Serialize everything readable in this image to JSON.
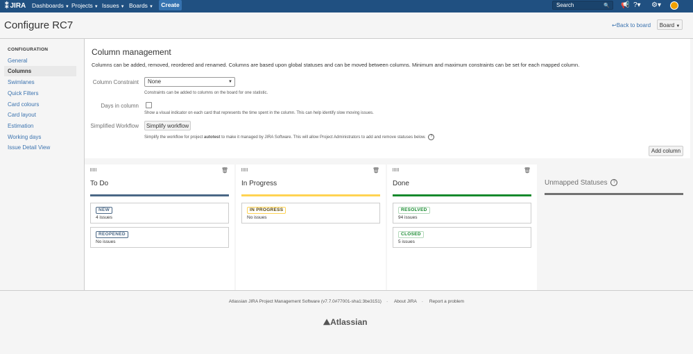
{
  "topnav": {
    "logo": "JIRA",
    "dashboards": "Dashboards",
    "projects": "Projects",
    "issues": "Issues",
    "boards": "Boards",
    "create": "Create",
    "search_placeholder": "Search"
  },
  "header": {
    "title": "Configure RC7",
    "back_label": "Back to board",
    "board_label": "Board"
  },
  "sidebar": {
    "heading": "CONFIGURATION",
    "items": [
      {
        "label": "General"
      },
      {
        "label": "Columns",
        "active": true
      },
      {
        "label": "Swimlanes"
      },
      {
        "label": "Quick Filters"
      },
      {
        "label": "Card colours"
      },
      {
        "label": "Card layout"
      },
      {
        "label": "Estimation"
      },
      {
        "label": "Working days"
      },
      {
        "label": "Issue Detail View"
      }
    ]
  },
  "main": {
    "title": "Column management",
    "description": "Columns can be added, removed, reordered and renamed. Columns are based upon global statuses and can be moved between columns. Minimum and maximum constraints can be set for each mapped column.",
    "constraint_label": "Column Constraint",
    "constraint_value": "None",
    "constraint_hint": "Constraints can be added to columns on the board for one statistic.",
    "days_label": "Days in column",
    "days_hint": "Show a visual indicator on each card that represents the time spent in the column. This can help identify slow moving issues.",
    "workflow_label": "Simplified Workflow",
    "workflow_button": "Simplify workflow",
    "workflow_hint_pre": "Simplify the workflow for project",
    "workflow_hint_project": "autotest",
    "workflow_hint_post": "to make it managed by JIRA Software. This will allow Project Administrators to add and remove statuses below.",
    "add_column": "Add column"
  },
  "columns": [
    {
      "title": "To Do",
      "bar_color": "#4a6785",
      "statuses": [
        {
          "name": "NEW",
          "count": "4 issues",
          "color": "#4a6785"
        },
        {
          "name": "REOPENED",
          "count": "No issues",
          "color": "#4a6785"
        }
      ]
    },
    {
      "title": "In Progress",
      "bar_color": "#ffd351",
      "statuses": [
        {
          "name": "IN PROGRESS",
          "count": "No issues",
          "color": "#594300"
        }
      ]
    },
    {
      "title": "Done",
      "bar_color": "#14892c",
      "statuses": [
        {
          "name": "RESOLVED",
          "count": "94 issues",
          "color": "#14892c"
        },
        {
          "name": "CLOSED",
          "count": "5 issues",
          "color": "#14892c"
        }
      ]
    }
  ],
  "unmapped": {
    "title": "Unmapped Statuses"
  },
  "footer": {
    "software": "Atlassian JIRA Project Management Software (v7.7.0#77001-sha1:3be3151)",
    "about": "About JIRA",
    "report": "Report a problem",
    "logo": "Atlassian"
  }
}
